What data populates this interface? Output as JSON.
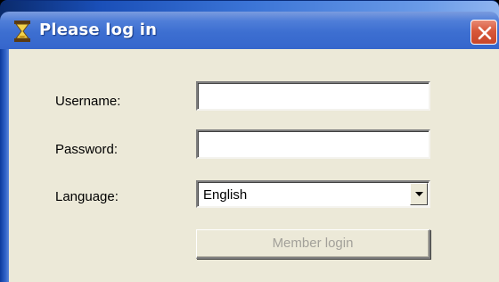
{
  "window": {
    "title": "Please log in",
    "icon": "hourglass-icon",
    "close_icon": "close-icon"
  },
  "form": {
    "username_label": "Username:",
    "username_value": "",
    "password_label": "Password:",
    "password_value": "",
    "language_label": "Language:",
    "language_selected": "English",
    "login_button": "Member login",
    "login_enabled": false
  },
  "colors": {
    "titlebar": "#3d6fd1",
    "client_bg": "#ece9d8",
    "close_button": "#d8583a",
    "disabled_text": "#a3a19a"
  }
}
